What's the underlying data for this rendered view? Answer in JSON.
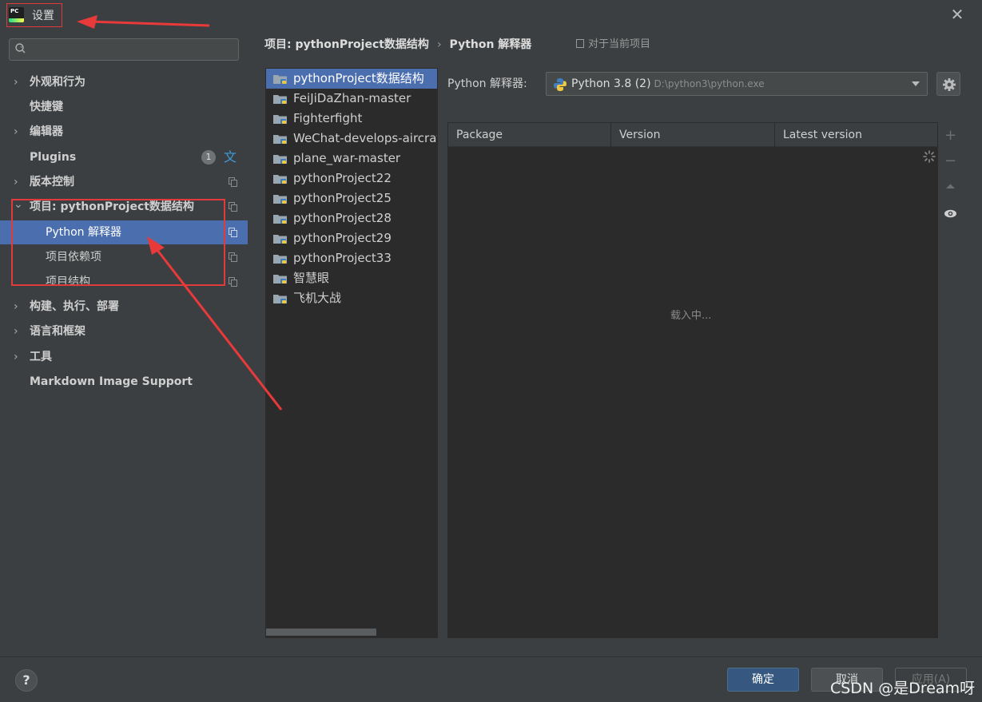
{
  "window": {
    "title": "设置",
    "app_icon_text": "PC"
  },
  "sidebar": {
    "search_placeholder": "",
    "items": [
      {
        "label": "外观和行为",
        "chevron": "›"
      },
      {
        "label": "快捷键"
      },
      {
        "label": "编辑器",
        "chevron": "›"
      },
      {
        "label": "Plugins",
        "badge": "1"
      },
      {
        "label": "版本控制",
        "chevron": "›"
      },
      {
        "label": "项目: pythonProject数据结构",
        "chevron": "⌄"
      },
      {
        "label": "Python 解释器"
      },
      {
        "label": "项目依赖项"
      },
      {
        "label": "项目结构"
      },
      {
        "label": "构建、执行、部署",
        "chevron": "›"
      },
      {
        "label": "语言和框架",
        "chevron": "›"
      },
      {
        "label": "工具",
        "chevron": "›"
      },
      {
        "label": "Markdown Image Support"
      }
    ]
  },
  "breadcrumb": {
    "project": "项目: pythonProject数据结构",
    "separator": "›",
    "page": "Python 解释器",
    "scope": "对于当前项目"
  },
  "projects": [
    "pythonProject数据结构",
    "FeiJiDaZhan-master",
    "Fighterfight",
    "WeChat-develops-aircraf",
    "plane_war-master",
    "pythonProject22",
    "pythonProject25",
    "pythonProject28",
    "pythonProject29",
    "pythonProject33",
    "智慧眼",
    "飞机大战"
  ],
  "interpreter": {
    "label": "Python 解释器:",
    "name": "Python 3.8 (2)",
    "path": "D:\\python3\\python.exe"
  },
  "packages": {
    "columns": [
      "Package",
      "Version",
      "Latest version"
    ],
    "loading_text": "载入中..."
  },
  "buttons": {
    "help": "?",
    "ok": "确定",
    "cancel": "取消",
    "apply": "应用(A)"
  },
  "watermark": "CSDN @是Dream呀",
  "colors": {
    "selection": "#4b6eaf",
    "annotation_red": "#e03a3a"
  }
}
